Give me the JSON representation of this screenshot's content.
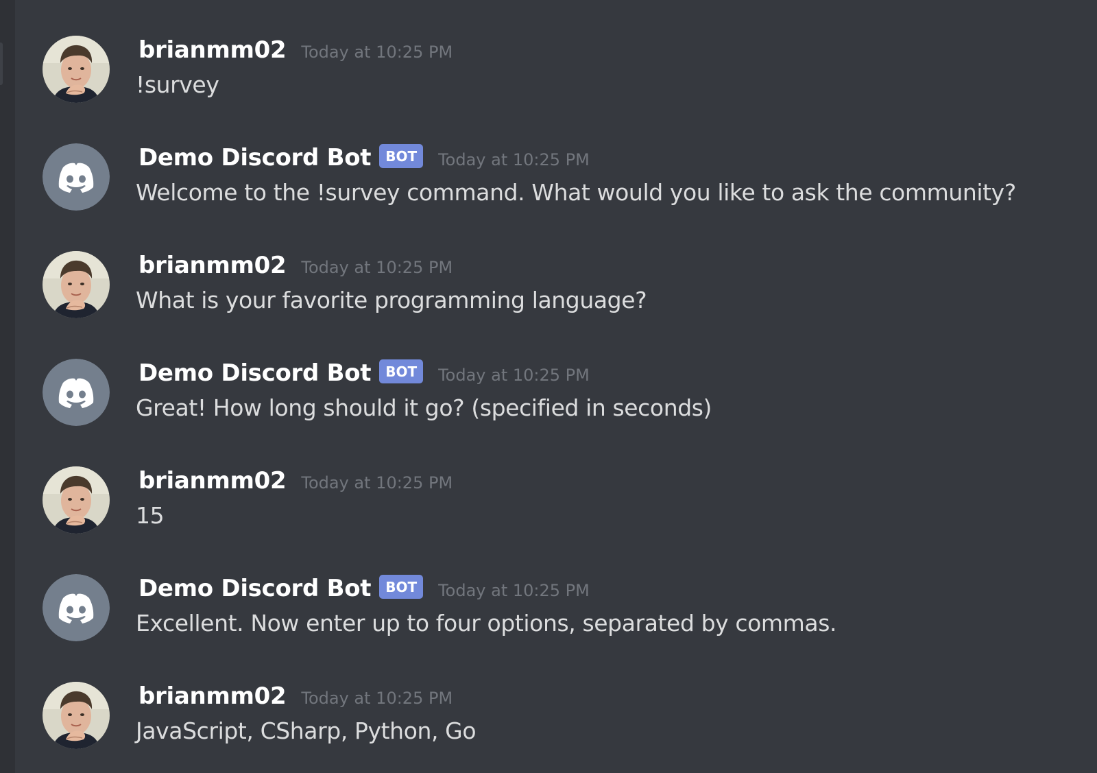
{
  "colors": {
    "background": "#36393f",
    "username": "#ffffff",
    "message_text": "#dcddde",
    "timestamp": "#72767d",
    "bot_tag": "#7289da",
    "bot_avatar_bg": "#747f8d"
  },
  "messages": [
    {
      "author": "brianmm02",
      "timestamp": "Today at 10:25 PM",
      "content": "!survey",
      "is_bot": false,
      "avatar_icon": "user-photo-avatar"
    },
    {
      "author": "Demo Discord Bot",
      "bot_tag": "BOT",
      "timestamp": "Today at 10:25 PM",
      "content": "Welcome to the !survey command. What would you like to ask the community?",
      "is_bot": true,
      "avatar_icon": "discord-logo-icon"
    },
    {
      "author": "brianmm02",
      "timestamp": "Today at 10:25 PM",
      "content": "What is your favorite programming language?",
      "is_bot": false,
      "avatar_icon": "user-photo-avatar"
    },
    {
      "author": "Demo Discord Bot",
      "bot_tag": "BOT",
      "timestamp": "Today at 10:25 PM",
      "content": "Great! How long should it go? (specified in seconds)",
      "is_bot": true,
      "avatar_icon": "discord-logo-icon"
    },
    {
      "author": "brianmm02",
      "timestamp": "Today at 10:25 PM",
      "content": "15",
      "is_bot": false,
      "avatar_icon": "user-photo-avatar"
    },
    {
      "author": "Demo Discord Bot",
      "bot_tag": "BOT",
      "timestamp": "Today at 10:25 PM",
      "content": "Excellent. Now enter up to four options, separated by commas.",
      "is_bot": true,
      "avatar_icon": "discord-logo-icon"
    },
    {
      "author": "brianmm02",
      "timestamp": "Today at 10:25 PM",
      "content": "JavaScript, CSharp, Python, Go",
      "is_bot": false,
      "avatar_icon": "user-photo-avatar"
    }
  ]
}
